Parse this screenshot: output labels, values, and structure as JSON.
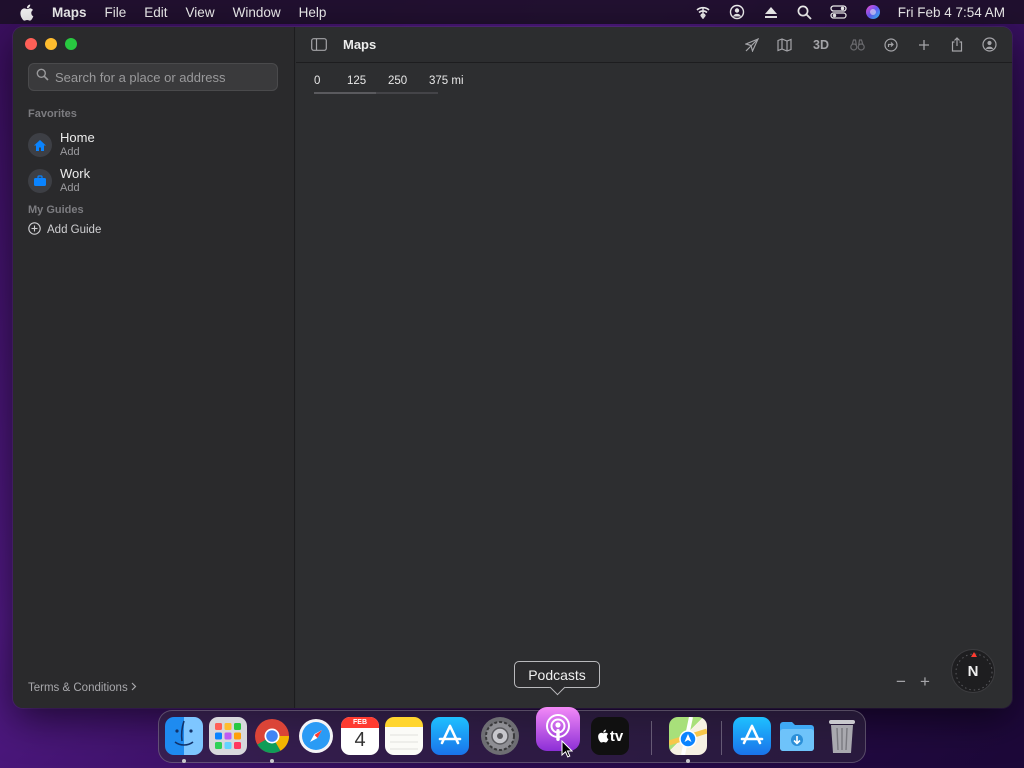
{
  "menubar": {
    "app_name": "Maps",
    "menus": [
      "File",
      "Edit",
      "View",
      "Window",
      "Help"
    ],
    "clock": "Fri Feb 4  7:54 AM",
    "status_icons": [
      "wifi-icon",
      "user-icon",
      "eject-icon",
      "search-icon",
      "control-center-icon",
      "siri-icon"
    ]
  },
  "sidebar": {
    "search_placeholder": "Search for a place or address",
    "favorites_title": "Favorites",
    "favorites": [
      {
        "name": "Home",
        "sub": "Add",
        "icon": "house-icon"
      },
      {
        "name": "Work",
        "sub": "Add",
        "icon": "briefcase-icon"
      }
    ],
    "guides_title": "My Guides",
    "add_guide_label": "Add Guide",
    "terms_label": "Terms & Conditions"
  },
  "map": {
    "title": "Maps",
    "toolbar_3d_label": "3D",
    "scale_labels": [
      "0",
      "125",
      "250",
      "375 mi"
    ],
    "compass_label": "N",
    "zoom_out_label": "−",
    "zoom_in_label": "+"
  },
  "tooltip": {
    "label": "Podcasts"
  },
  "dock": {
    "apps": [
      "Finder",
      "Launchpad",
      "Chrome",
      "Safari",
      "Calendar",
      "Notes",
      "App Store",
      "System Preferences",
      "Podcasts",
      "TV",
      "Maps",
      "App Store",
      "Downloads",
      "Trash"
    ],
    "calendar_month": "FEB",
    "calendar_day": "4",
    "tv_label": "tv"
  },
  "colors": {
    "accent": "#0a84ff",
    "close": "#fe5f57",
    "minimize": "#febc2e",
    "zoom": "#28c840",
    "podcasts": "#b84be8"
  }
}
